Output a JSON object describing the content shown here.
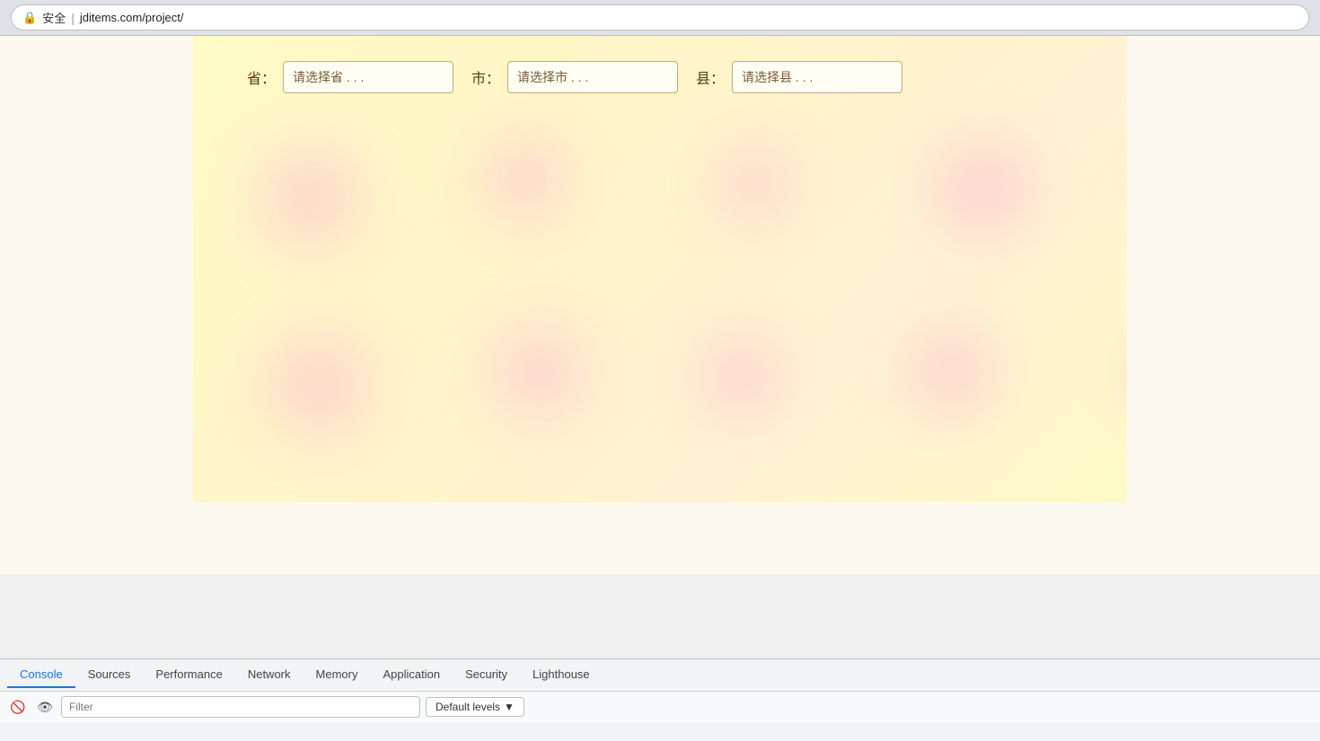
{
  "browser": {
    "security_label": "安全",
    "url": "jditems.com/project/"
  },
  "page": {
    "province_label": "省：",
    "city_label": "市：",
    "county_label": "县：",
    "province_placeholder": "请选择省 . . .",
    "city_placeholder": "请选择市 . . .",
    "county_placeholder": "请选择县 . . ."
  },
  "devtools": {
    "tabs": [
      {
        "id": "console",
        "label": "Console",
        "active": true
      },
      {
        "id": "sources",
        "label": "Sources",
        "active": false
      },
      {
        "id": "performance",
        "label": "Performance",
        "active": false
      },
      {
        "id": "network",
        "label": "Network",
        "active": false
      },
      {
        "id": "memory",
        "label": "Memory",
        "active": false
      },
      {
        "id": "application",
        "label": "Application",
        "active": false
      },
      {
        "id": "security",
        "label": "Security",
        "active": false
      },
      {
        "id": "lighthouse",
        "label": "Lighthouse",
        "active": false
      }
    ],
    "toolbar": {
      "filter_placeholder": "Filter",
      "levels_label": "Default levels"
    }
  }
}
